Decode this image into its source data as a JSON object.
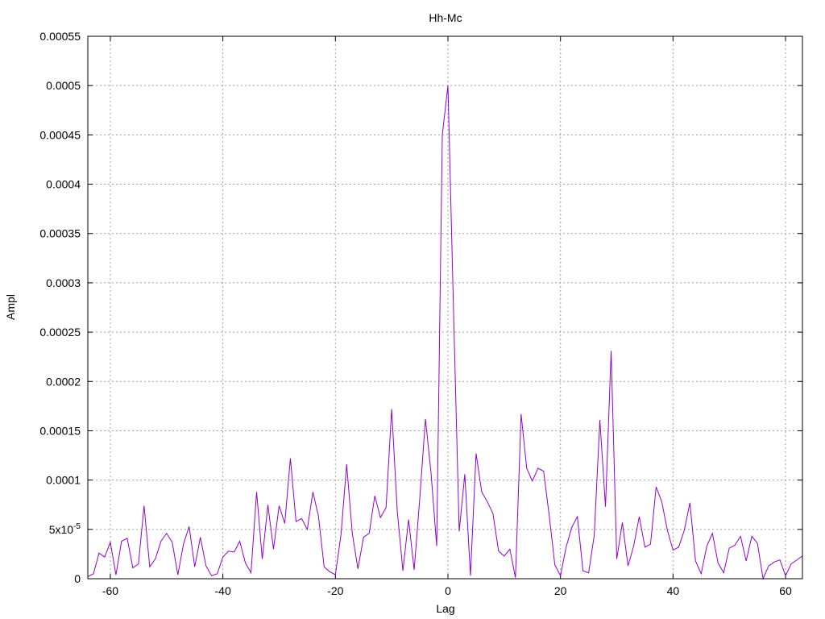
{
  "chart_data": {
    "type": "line",
    "title": "Hh-Mc",
    "xlabel": "Lag",
    "ylabel": "Ampl",
    "xlim": [
      -64,
      63
    ],
    "ylim": [
      0,
      0.00055
    ],
    "grid": true,
    "x_ticks": [
      -60,
      -40,
      -20,
      0,
      20,
      40,
      60
    ],
    "x_tick_labels": [
      "-60",
      "-40",
      "-20",
      "0",
      "20",
      "40",
      "60"
    ],
    "y_ticks": [
      0,
      5e-05,
      0.0001,
      0.00015,
      0.0002,
      0.00025,
      0.0003,
      0.00035,
      0.0004,
      0.00045,
      0.0005,
      0.00055
    ],
    "y_tick_labels": [
      "0",
      "5x10-5",
      "0.0001",
      "0.00015",
      "0.0002",
      "0.00025",
      "0.0003",
      "0.00035",
      "0.0004",
      "0.00045",
      "0.0005",
      "0.00055"
    ],
    "colors": {
      "series": "#9400d3",
      "frame": "#000000",
      "grid": "#a0a0a0"
    },
    "series": [
      {
        "x": [
          -64,
          -63,
          -62,
          -61,
          -60,
          -59,
          -58,
          -57,
          -56,
          -55,
          -54,
          -53,
          -52,
          -51,
          -50,
          -49,
          -48,
          -47,
          -46,
          -45,
          -44,
          -43,
          -42,
          -41,
          -40,
          -39,
          -38,
          -37,
          -36,
          -35,
          -34,
          -33,
          -32,
          -31,
          -30,
          -29,
          -28,
          -27,
          -26,
          -25,
          -24,
          -23,
          -22,
          -21,
          -20,
          -19,
          -18,
          -17,
          -16,
          -15,
          -14,
          -13,
          -12,
          -11,
          -10,
          -9,
          -8,
          -7,
          -6,
          -5,
          -4,
          -3,
          -2,
          -1,
          0,
          1,
          2,
          3,
          4,
          5,
          6,
          7,
          8,
          9,
          10,
          11,
          12,
          13,
          14,
          15,
          16,
          17,
          18,
          19,
          20,
          21,
          22,
          23,
          24,
          25,
          26,
          27,
          28,
          29,
          30,
          31,
          32,
          33,
          34,
          35,
          36,
          37,
          38,
          39,
          40,
          41,
          42,
          43,
          44,
          45,
          46,
          47,
          48,
          49,
          50,
          51,
          52,
          53,
          54,
          55,
          56,
          57,
          58,
          59,
          60,
          61,
          62,
          63
        ],
        "y": [
          2e-06,
          5e-06,
          2.6e-05,
          2.2e-05,
          3.7e-05,
          4e-06,
          3.8e-05,
          4.1e-05,
          1.1e-05,
          1.5e-05,
          7.4e-05,
          1.2e-05,
          2e-05,
          3.8e-05,
          4.6e-05,
          3.7e-05,
          4e-06,
          3.5e-05,
          5.3e-05,
          1.2e-05,
          4.2e-05,
          1.3e-05,
          3e-06,
          5e-06,
          2.2e-05,
          2.8e-05,
          2.7e-05,
          3.8e-05,
          1.6e-05,
          6e-06,
          8.8e-05,
          2e-05,
          7.5e-05,
          3e-05,
          7.4e-05,
          5.6e-05,
          0.000122,
          5.8e-05,
          6.1e-05,
          5e-05,
          8.8e-05,
          6.3e-05,
          1.2e-05,
          7e-06,
          4e-06,
          4.5e-05,
          0.000116,
          4.6e-05,
          1e-05,
          4.2e-05,
          4.6e-05,
          8.4e-05,
          6.2e-05,
          7.2e-05,
          0.000172,
          6.8e-05,
          8e-06,
          6e-05,
          9e-06,
          8.2e-05,
          0.000162,
          0.000107,
          3.3e-05,
          0.00045,
          0.0005,
          0.00027,
          4.8e-05,
          0.000106,
          3e-06,
          0.000127,
          8.8e-05,
          7.8e-05,
          6.6e-05,
          2.8e-05,
          2.3e-05,
          3e-05,
          1e-06,
          0.000167,
          0.000112,
          9.9e-05,
          0.000112,
          0.000109,
          6.4e-05,
          1.4e-05,
          3e-06,
          3.2e-05,
          5.2e-05,
          6.3e-05,
          8e-06,
          6e-06,
          4.4e-05,
          0.000161,
          7.3e-05,
          0.000231,
          2e-05,
          5.7e-05,
          1.3e-05,
          3.3e-05,
          6.3e-05,
          3.2e-05,
          3.5e-05,
          9.3e-05,
          7.8e-05,
          4.9e-05,
          2.9e-05,
          3.2e-05,
          4.9e-05,
          7.7e-05,
          1.8e-05,
          5e-06,
          3.3e-05,
          4.6e-05,
          1.6e-05,
          6e-06,
          3.1e-05,
          3.4e-05,
          4.3e-05,
          1.8e-05,
          4.3e-05,
          3.6e-05,
          0.0,
          1.3e-05,
          1.7e-05,
          1.9e-05,
          3e-06,
          1.5e-05,
          1.9e-05,
          2.3e-05
        ]
      }
    ]
  }
}
